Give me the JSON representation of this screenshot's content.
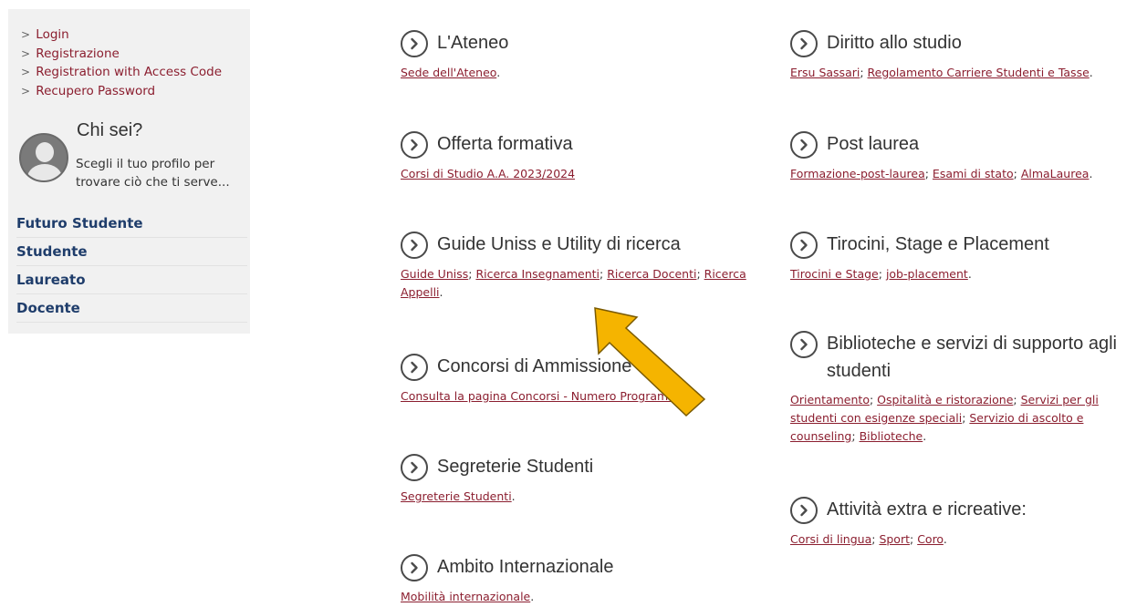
{
  "sidebar": {
    "auth_links": [
      {
        "label": "Login"
      },
      {
        "label": "Registrazione"
      },
      {
        "label": "Registration with Access Code"
      },
      {
        "label": "Recupero Password"
      }
    ],
    "profile": {
      "title": "Chi sei?",
      "description": "Scegli il tuo profilo per trovare ciò che ti serve..."
    },
    "roles": [
      {
        "label": "Futuro Studente"
      },
      {
        "label": "Studente"
      },
      {
        "label": "Laureato"
      },
      {
        "label": "Docente"
      }
    ]
  },
  "left_sections": [
    {
      "title": "L'Ateneo",
      "links": [
        "Sede dell'Ateneo"
      ],
      "tail": "."
    },
    {
      "title": "Offerta formativa",
      "links": [
        "Corsi di Studio A.A. 2023/2024"
      ],
      "tail": ""
    },
    {
      "title": "Guide Uniss e Utility di ricerca",
      "links": [
        "Guide Uniss",
        "Ricerca Insegnamenti",
        "Ricerca Docenti",
        "Ricerca Appelli"
      ],
      "tail": "."
    },
    {
      "title": "Concorsi di Ammissione",
      "links": [
        "Consulta la pagina Concorsi - Numero Programmato"
      ],
      "tail": ""
    },
    {
      "title": "Segreterie Studenti",
      "links": [
        "Segreterie Studenti"
      ],
      "tail": "."
    },
    {
      "title": "Ambito Internazionale",
      "links": [
        "Mobilità internazionale"
      ],
      "tail": "."
    }
  ],
  "right_sections": [
    {
      "title": "Diritto allo studio",
      "links": [
        "Ersu Sassari",
        "Regolamento Carriere Studenti e Tasse"
      ],
      "tail": "."
    },
    {
      "title": "Post laurea",
      "links": [
        "Formazione-post-laurea",
        "Esami di stato",
        "AlmaLaurea"
      ],
      "tail": "."
    },
    {
      "title": "Tirocini, Stage e Placement",
      "links": [
        "Tirocini e Stage",
        "job-placement"
      ],
      "tail": "."
    },
    {
      "title": "Biblioteche e servizi di supporto agli studenti",
      "links": [
        "Orientamento",
        "Ospitalità e ristorazione",
        "Servizi per gli studenti con esigenze speciali",
        "Servizio di ascolto e counseling",
        "Biblioteche"
      ],
      "tail": "."
    },
    {
      "title": "Attività extra e ricreative:",
      "links": [
        "Corsi di lingua",
        "Sport",
        "Coro"
      ],
      "tail": "."
    }
  ],
  "overlay": {
    "arrow_color": "#f5b400",
    "arrow_stroke": "#7a5a00"
  },
  "colors": {
    "link": "#8b1e2f",
    "role": "#1f3d6b",
    "sidebar_bg": "#f1f1f1"
  }
}
